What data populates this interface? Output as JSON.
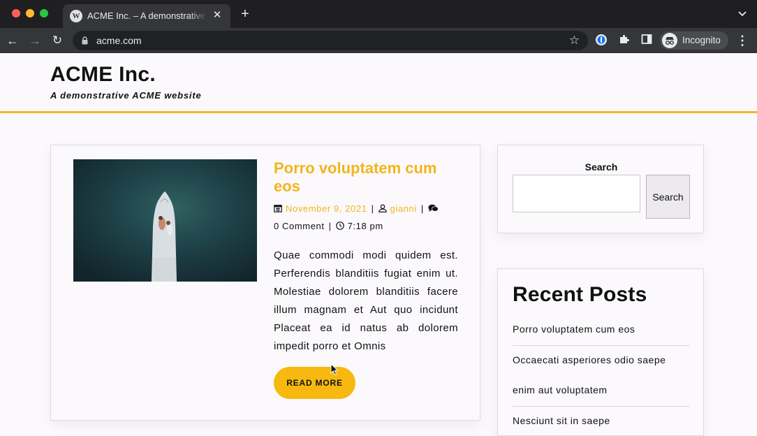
{
  "browser": {
    "tab_title": "ACME Inc. – A demonstrative ACME website",
    "url": "acme.com",
    "profile_label": "Incognito"
  },
  "site": {
    "title": "ACME Inc.",
    "tagline": "A demonstrative ACME website"
  },
  "post": {
    "title": "Porro voluptatem cum eos",
    "date": "November 9, 2021",
    "author": "gianni",
    "comments": "0 Comment",
    "time": "7:18 pm",
    "excerpt": "Quae commodi modi quidem est. Perferendis blanditiis fugiat enim ut. Molestiae dolorem blanditiis facere illum magnam et Aut quo incidunt Placeat ea id natus ab dolorem impedit porro et Omnis",
    "read_more": "READ MORE"
  },
  "sidebar": {
    "search": {
      "label": "Search",
      "value": "",
      "button": "Search"
    },
    "recent": {
      "title": "Recent Posts",
      "items": [
        "Porro voluptatem cum eos",
        "Occaecati asperiores odio saepe",
        "enim aut voluptatem",
        "Nesciunt sit in saepe"
      ]
    }
  },
  "colors": {
    "accent": "#f2b51c",
    "button": "#f7b90f",
    "header_border": "#f0b52b"
  }
}
